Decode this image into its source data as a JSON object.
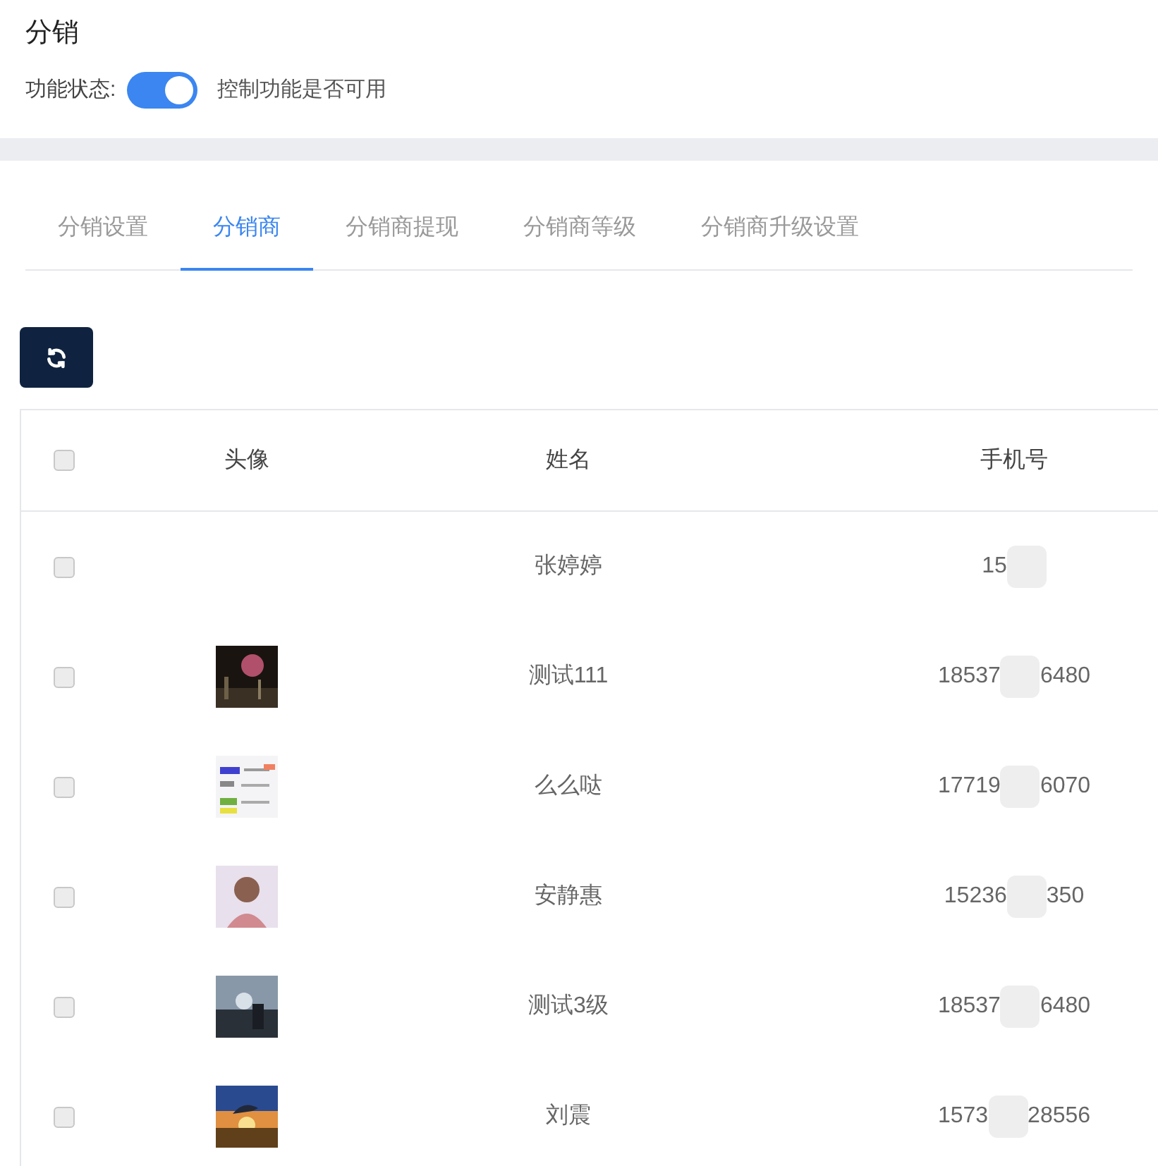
{
  "title": "分销",
  "feature_status": {
    "label": "功能状态:",
    "on": true,
    "hint": "控制功能是否可用"
  },
  "tabs": [
    {
      "label": "分销设置",
      "selected": false
    },
    {
      "label": "分销商",
      "selected": true
    },
    {
      "label": "分销商提现",
      "selected": false
    },
    {
      "label": "分销商等级",
      "selected": false
    },
    {
      "label": "分销商升级设置",
      "selected": false
    }
  ],
  "table": {
    "select_all": {
      "checked": false
    },
    "columns": [
      "头像",
      "姓名",
      "手机号"
    ],
    "rows": [
      {
        "checked": false,
        "name": "张婷婷",
        "phone": {
          "start": "15"
        }
      },
      {
        "checked": false,
        "name": "测试111",
        "phone": {
          "start": "18537",
          "end": "6480"
        }
      },
      {
        "checked": false,
        "name": "么么哒",
        "phone": {
          "start": "17719",
          "end": "6070"
        }
      },
      {
        "checked": false,
        "name": "安静惠",
        "phone": {
          "start": "15236",
          "end": "350"
        }
      },
      {
        "checked": false,
        "name": "测试3级",
        "phone": {
          "start": "18537",
          "end": "6480"
        }
      },
      {
        "checked": false,
        "name": "刘震",
        "phone": {
          "start": "1573",
          "end": "28556"
        }
      }
    ]
  }
}
